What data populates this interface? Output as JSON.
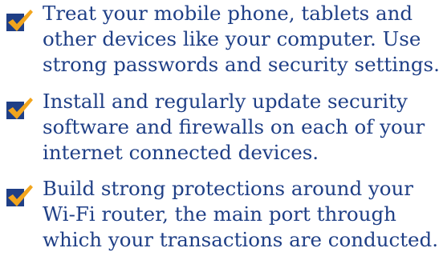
{
  "checklist": {
    "items": [
      {
        "lines": [
          "Treat your mobile phone, tablets and",
          "other devices like your computer. Use",
          "strong passwords and security settings."
        ]
      },
      {
        "lines": [
          "Install and regularly update security",
          "software and firewalls on each of your",
          "internet connected devices."
        ]
      },
      {
        "lines": [
          "Build strong protections around your",
          "Wi-Fi router, the main port through",
          "which your transactions are conducted."
        ]
      }
    ],
    "colors": {
      "text": "#1f3f86",
      "box": "#1f3f86",
      "check": "#f2a51d"
    },
    "icon": "checkbox-checked-icon"
  }
}
